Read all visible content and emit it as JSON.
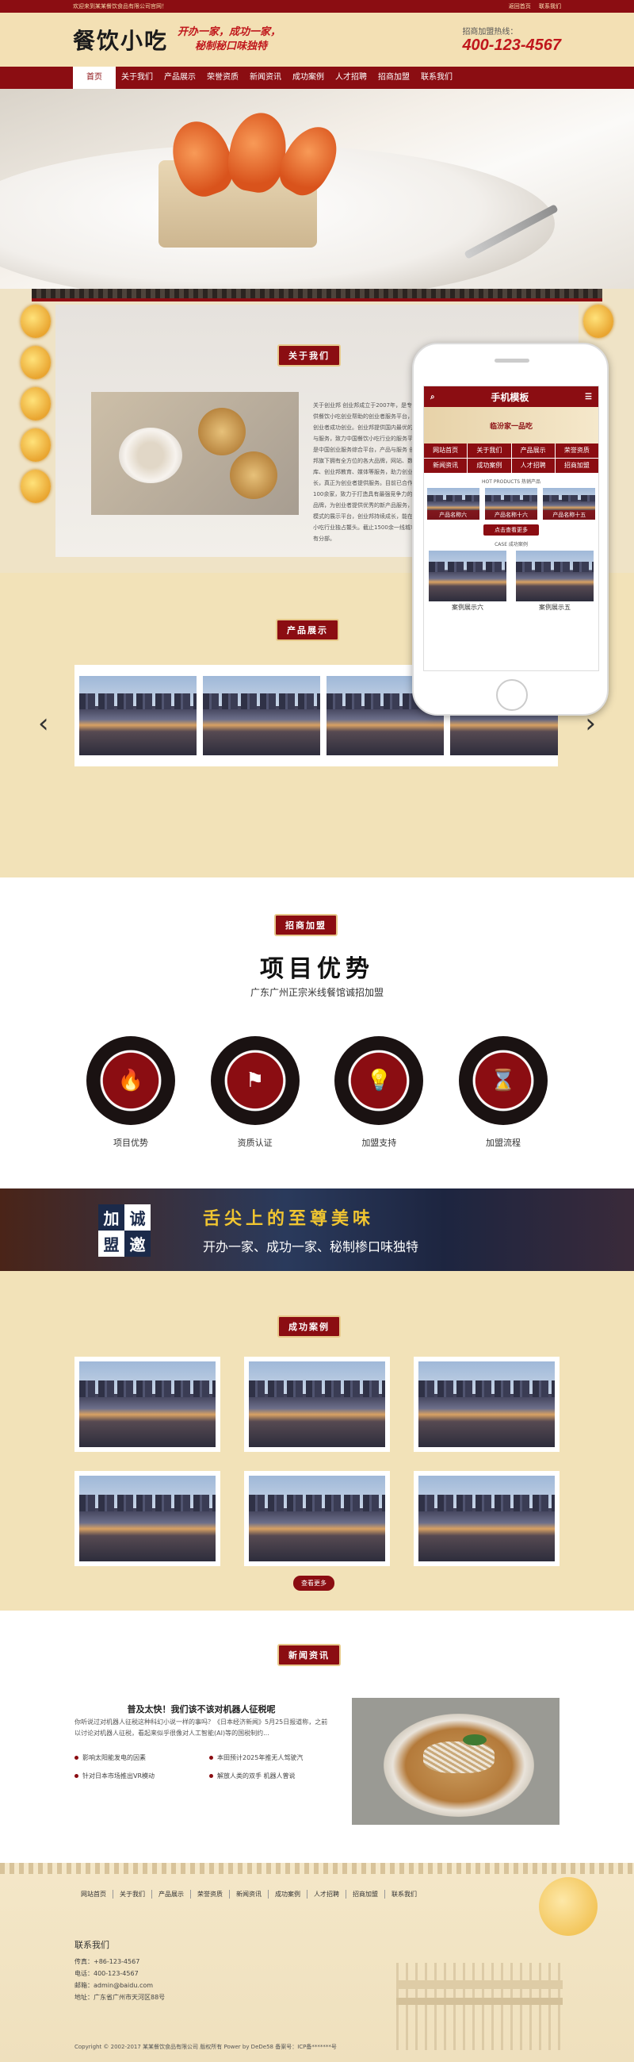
{
  "topbar": {
    "welcome": "欢迎来到某某餐饮食品有限公司官网！",
    "links": [
      "返回首页",
      "联系我们"
    ]
  },
  "header": {
    "logo": "餐饮小吃",
    "slogan_1": "开办一家，成功一家，",
    "slogan_2": "秘制秘口味独特",
    "hotline_label": "招商加盟热线：",
    "hotline": "400-123-4567"
  },
  "nav": {
    "items": [
      "首页",
      "关于我们",
      "产品展示",
      "荣誉资质",
      "新闻资讯",
      "成功案例",
      "人才招聘",
      "招商加盟",
      "联系我们"
    ]
  },
  "about": {
    "title": "关于我们",
    "text": "关于创业邦 创业邦成立于2007年，是专业提供餐饮小吃创业帮助的创业者服务平台，推动创业者成功创业。创业邦提供国内最优的资讯与服务，致力中国餐饮小吃行业的服务平台。是中国创业服务综合平台，产品与服务 创业邦旗下拥有全方位的各大品牌，网站、数据库、创业邦教育、媒体等服务，助力创业者成长，真正为创业者提供服务。目前已合作超过100余家，致力于打造具有最强竞争力的餐饮品牌，为创业者提供优秀的新产品服务，商业模式的展示平台，创业邦持续成长，能在餐饮小吃行业独占鳌头。截止1500余一线城市拥有分部。"
  },
  "phone": {
    "title": "手机模板",
    "banner_text": "临汾家一品吃",
    "nav": [
      "网站首页",
      "关于我们",
      "产品展示",
      "荣誉资质",
      "新闻资讯",
      "成功案例",
      "人才招聘",
      "招商加盟"
    ],
    "products_label": "HOT PRODUCTS 热销产品",
    "products": [
      "产品名称六",
      "产品名称十六",
      "产品名称十五"
    ],
    "more": "点击查看更多",
    "case_label": "CASE 成功案例",
    "cases": [
      "案例展示六",
      "案例展示五"
    ]
  },
  "products": {
    "title": "产品展示",
    "prev": "‹",
    "next": "›"
  },
  "advantages": {
    "title": "招商加盟",
    "heading": "项目优势",
    "subheading": "广东广州正宗米线餐馆诚招加盟",
    "items": [
      {
        "label": "项目优势",
        "icon": "flame-icon"
      },
      {
        "label": "资质认证",
        "icon": "flag-icon"
      },
      {
        "label": "加盟支持",
        "icon": "lightbulb-icon"
      },
      {
        "label": "加盟流程",
        "icon": "hourglass-icon"
      }
    ]
  },
  "join": {
    "seal": [
      "加",
      "诚",
      "盟",
      "邀"
    ],
    "title": "舌尖上的至尊美味",
    "subtitle": "开办一家、成功一家、秘制椮口味独特"
  },
  "cases": {
    "title": "成功案例",
    "more": "查看更多"
  },
  "news": {
    "title": "新闻资讯",
    "headline": "普及太快！我们该不该对机器人征税呢",
    "summary": "你听说过对机器人征税这种科幻小说一样的事吗？《日本经济新闻》5月25日报道称，之前以讨论对机器人征税，看起来似乎很像对人工智能(AI)等的国税制约...",
    "items": [
      "影响太阳能发电的因素",
      "本田预计2025年推无人驾驶汽",
      "针对日本市场推出VR模动",
      "解放人类的双手 机器人曾说"
    ]
  },
  "footer": {
    "links": [
      "网站首页",
      "关于我们",
      "产品展示",
      "荣誉资质",
      "新闻资讯",
      "成功案例",
      "人才招聘",
      "招商加盟",
      "联系我们"
    ],
    "contact_title": "联系我们",
    "phone": "传真：+86-123-4567",
    "tel": "电话：400-123-4567",
    "email": "邮箱：admin@baidu.com",
    "address": "地址：广东省广州市天河区88号",
    "copyright": "Copyright © 2002-2017 某某餐饮食品有限公司 版权所有 Power by DeDe58 备案号：ICP备*******号"
  },
  "colors": {
    "brand_red": "#8b0d12",
    "cream": "#f2e2b8",
    "hotline_red": "#c0171c"
  }
}
